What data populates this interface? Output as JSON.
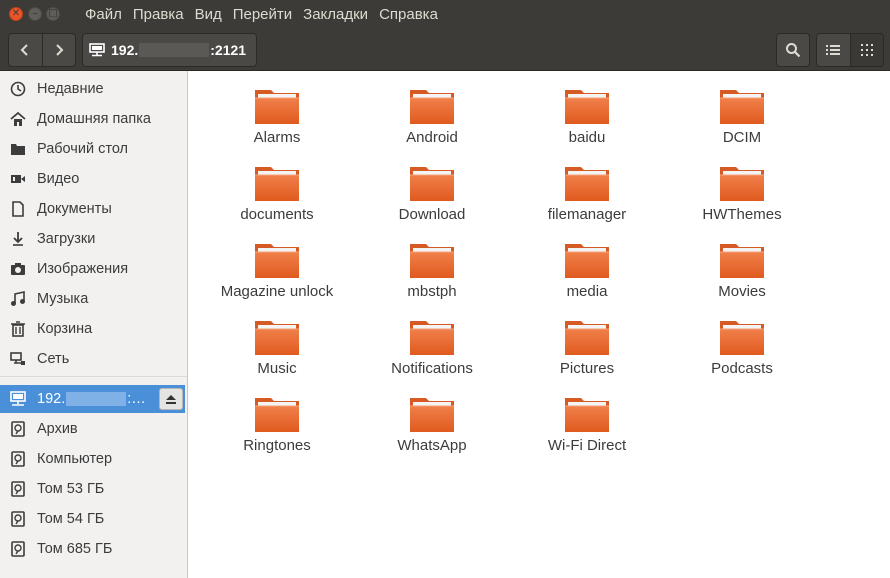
{
  "window": {
    "controls": [
      "close",
      "minimize",
      "maximize"
    ]
  },
  "menubar": {
    "items": [
      "Файл",
      "Правка",
      "Вид",
      "Перейти",
      "Закладки",
      "Справка"
    ]
  },
  "toolbar": {
    "path_prefix": "192.",
    "path_suffix": ":2121",
    "back_icon": "chevron-left-icon",
    "forward_icon": "chevron-right-icon",
    "search_icon": "search-icon",
    "list_view_icon": "list-view-icon",
    "grid_view_icon": "grid-view-icon"
  },
  "sidebar": {
    "places": [
      {
        "label": "Недавние",
        "icon": "clock-icon"
      },
      {
        "label": "Домашняя папка",
        "icon": "home-icon"
      },
      {
        "label": "Рабочий стол",
        "icon": "desktop-folder-icon"
      },
      {
        "label": "Видео",
        "icon": "video-icon"
      },
      {
        "label": "Документы",
        "icon": "document-icon"
      },
      {
        "label": "Загрузки",
        "icon": "download-icon"
      },
      {
        "label": "Изображения",
        "icon": "camera-icon"
      },
      {
        "label": "Музыка",
        "icon": "music-icon"
      },
      {
        "label": "Корзина",
        "icon": "trash-icon"
      },
      {
        "label": "Сеть",
        "icon": "network-icon"
      }
    ],
    "devices": [
      {
        "label_prefix": "192.",
        "label_suffix": ":…",
        "icon": "network-drive-icon",
        "selected": true
      },
      {
        "label": "Архив",
        "icon": "drive-icon"
      },
      {
        "label": "Компьютер",
        "icon": "drive-icon"
      },
      {
        "label": "Том 53 ГБ",
        "icon": "drive-icon"
      },
      {
        "label": "Том 54 ГБ",
        "icon": "drive-icon"
      },
      {
        "label": "Том 685 ГБ",
        "icon": "drive-icon"
      }
    ]
  },
  "files": [
    "Alarms",
    "Android",
    "baidu",
    "DCIM",
    "documents",
    "Download",
    "filemanager",
    "HWThemes",
    "Magazine unlock",
    "mbstph",
    "media",
    "Movies",
    "Music",
    "Notifications",
    "Pictures",
    "Podcasts",
    "Ringtones",
    "WhatsApp",
    "Wi-Fi Direct"
  ],
  "colors": {
    "accent": "#4a90d9",
    "folder_top": "#f0804a",
    "folder_bottom": "#e05a1e",
    "titlebar": "#3c3b37"
  }
}
